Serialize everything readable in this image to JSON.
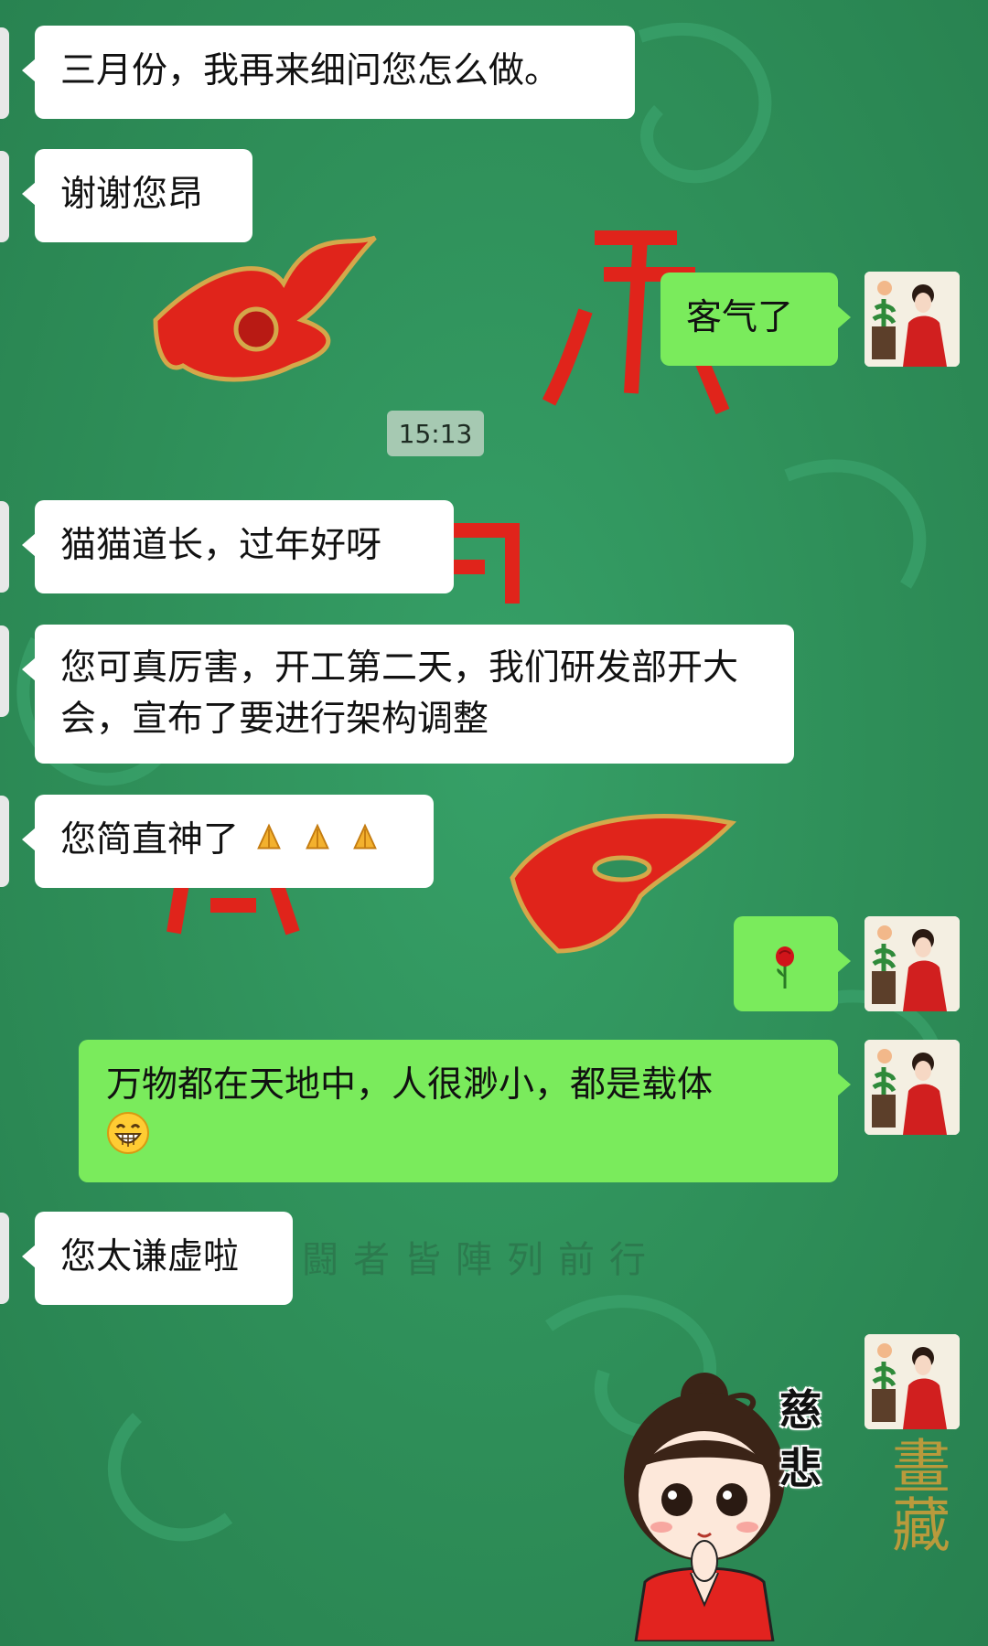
{
  "chat": {
    "timestamp": "15:13",
    "messages": [
      {
        "side": "in",
        "text": "三月份，我再来细问您怎么做。"
      },
      {
        "side": "in",
        "text": "谢谢您昂"
      },
      {
        "side": "out",
        "text": "客气了"
      },
      {
        "side": "in",
        "text": "猫猫道长，过年好呀"
      },
      {
        "side": "in",
        "text": "您可真厉害，开工第二天，我们研发部开大会，宣布了要进行架构调整"
      },
      {
        "side": "in",
        "text": "您简直神了"
      },
      {
        "side": "out",
        "text": "",
        "emoji": "rose-icon"
      },
      {
        "side": "out",
        "text": "万物都在天地中，人很渺小，都是载体"
      },
      {
        "side": "in",
        "text": "您太谦虚啦"
      },
      {
        "side": "out",
        "text": "",
        "sticker": "ci-bei-sticker"
      }
    ],
    "sticker_text": "慈悲"
  },
  "background": {
    "overlay_text": "闘者皆陣列前行",
    "corner_text": "畫藏",
    "colors": {
      "base": "#2f8f5b",
      "red": "#e0241b",
      "gold": "#d4a84a"
    }
  },
  "colors": {
    "incoming_bubble": "#ffffff",
    "outgoing_bubble": "#7aeb5c",
    "timestamp_bg": "#a6c9b2"
  }
}
